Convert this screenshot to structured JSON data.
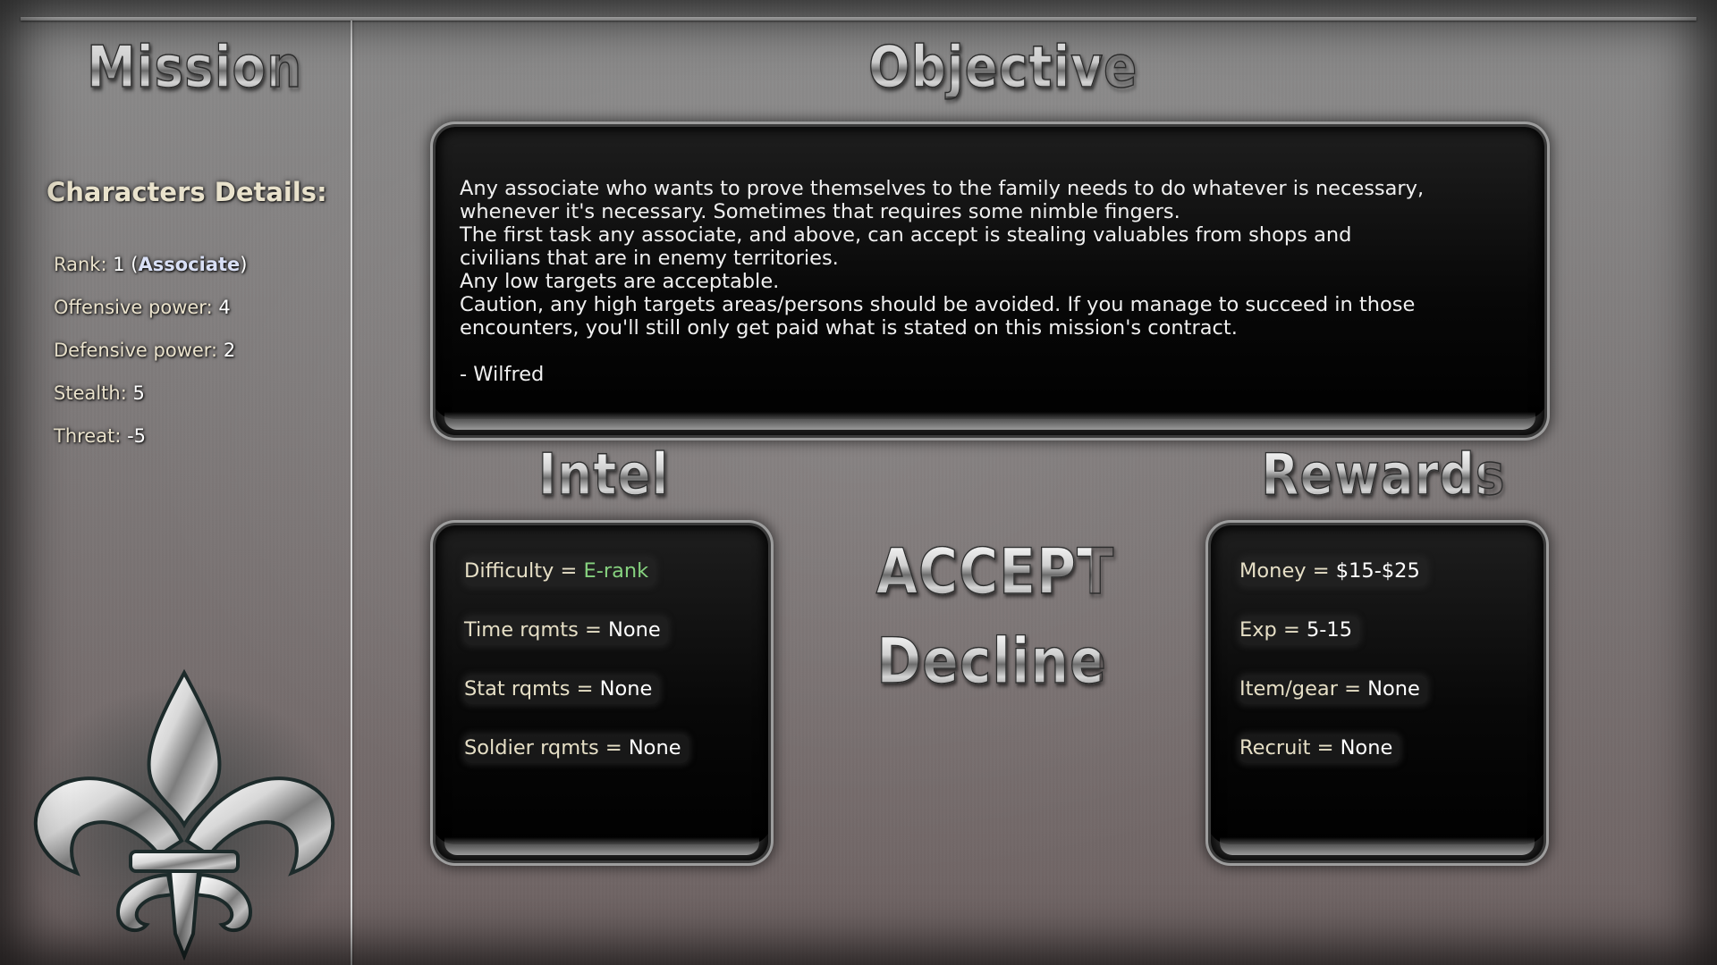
{
  "headings": {
    "mission": "Mission",
    "objective": "Objective",
    "intel": "Intel",
    "rewards": "Rewards"
  },
  "buttons": {
    "accept": "ACCEPT",
    "decline": "Decline"
  },
  "character": {
    "title": "Characters Details:",
    "rank_label": "Rank:",
    "rank_value": "1",
    "rank_name": "Associate",
    "offensive_label": "Offensive power:",
    "offensive_value": "4",
    "defensive_label": "Defensive power:",
    "defensive_value": "2",
    "stealth_label": "Stealth:",
    "stealth_value": "5",
    "threat_label": "Threat:",
    "threat_value": "-5"
  },
  "objective": {
    "lines": [
      "Any associate who wants to prove themselves to the family needs to do whatever is necessary,",
      "whenever it's necessary. Sometimes that requires some nimble fingers.",
      "The first task any associate, and above, can accept is stealing valuables from shops and",
      "civilians that are in enemy territories.",
      "Any low targets are acceptable.",
      "Caution, any high targets areas/persons should be avoided. If you manage to succeed in those",
      "encounters, you'll still only get paid what is stated on this mission's contract."
    ],
    "signature": "- Wilfred"
  },
  "intel": {
    "difficulty_label": "Difficulty =",
    "difficulty_value": "E-rank",
    "time_label": "Time rqmts =",
    "time_value": "None",
    "stat_label": "Stat rqmts =",
    "stat_value": "None",
    "soldier_label": "Soldier rqmts =",
    "soldier_value": "None"
  },
  "rewards": {
    "money_label": "Money =",
    "money_value": "$15-$25",
    "exp_label": "Exp =",
    "exp_value": "5-15",
    "item_label": "Item/gear =",
    "item_value": "None",
    "recruit_label": "Recruit =",
    "recruit_value": "None"
  },
  "colors": {
    "difficulty_green": "#86d27f",
    "label_cream": "#e6dfc6",
    "rank_blue": "#d9e0f6"
  },
  "icons": {
    "emblem": "fleur-de-lis-icon"
  }
}
